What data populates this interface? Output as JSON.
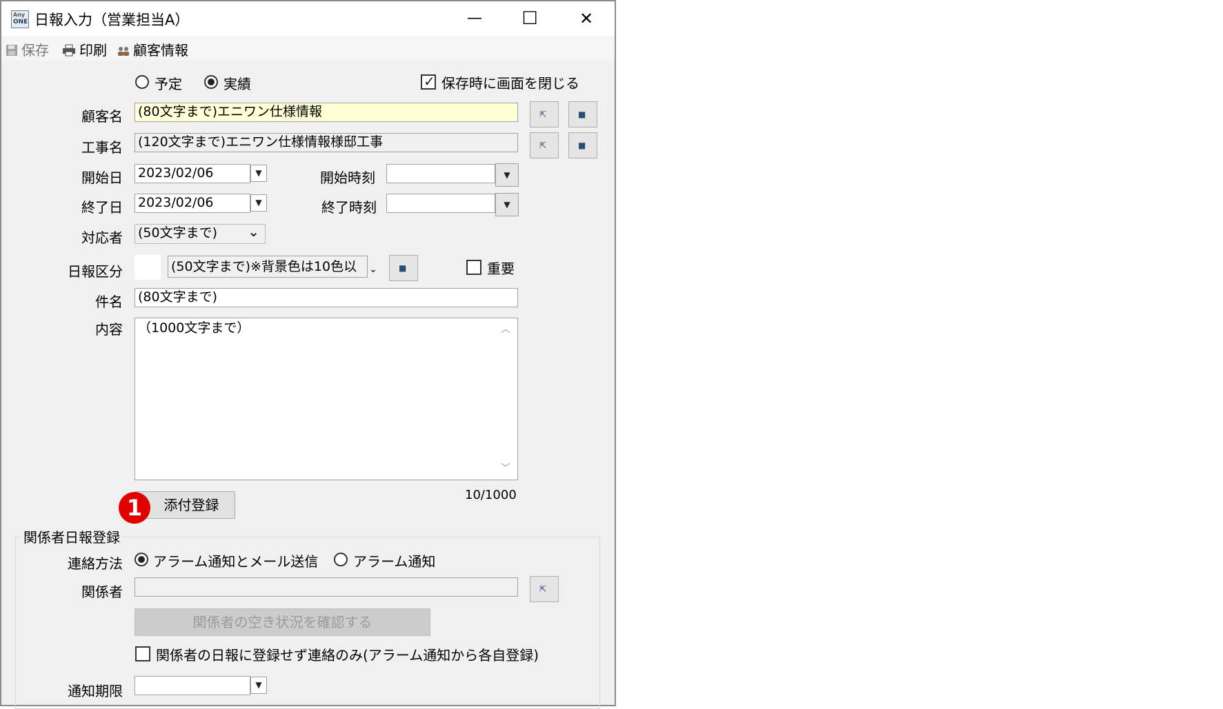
{
  "window": {
    "title": "日報入力（営業担当A）",
    "app_icon_top": "Any",
    "app_icon_bottom": "ONE",
    "minimize_glyph": "—",
    "maximize_glyph": "☐",
    "close_glyph": "✕"
  },
  "toolbar": {
    "save_label": "保存",
    "print_label": "印刷",
    "customer_info_label": "顧客情報"
  },
  "mode": {
    "plan_label": "予定",
    "actual_label": "実績",
    "selected": "actual",
    "close_on_save_label": "保存時に画面を閉じる",
    "close_on_save_checked": true
  },
  "form": {
    "customer_label": "顧客名",
    "customer_value": "(80文字まで)エニワン仕様情報",
    "project_label": "工事名",
    "project_value": "(120文字まで)エニワン仕様情報様邸工事",
    "start_date_label": "開始日",
    "start_date_value": "2023/02/06",
    "start_time_label": "開始時刻",
    "start_time_value": "",
    "end_date_label": "終了日",
    "end_date_value": "2023/02/06",
    "end_time_label": "終了時刻",
    "end_time_value": "",
    "handler_label": "対応者",
    "handler_value": "(50文字まで)",
    "category_label": "日報区分",
    "category_value": "(50文字まで)※背景色は10色以",
    "important_label": "重要",
    "important_checked": false,
    "subject_label": "件名",
    "subject_value": "(80文字まで)",
    "content_label": "内容",
    "content_value": "（1000文字まで）",
    "char_count": "10/1000",
    "attach_button_label": "添付登録",
    "badge_number": "1"
  },
  "related": {
    "group_title": "関係者日報登録",
    "contact_method_label": "連絡方法",
    "option_alarm_mail_label": "アラーム通知とメール送信",
    "option_alarm_label": "アラーム通知",
    "selected_option": "alarm_mail",
    "persons_label": "関係者",
    "persons_value": "",
    "check_availability_label": "関係者の空き状況を確認する",
    "notify_only_label": "関係者の日報に登録せず連絡のみ(アラーム通知から各自登録)",
    "notify_only_checked": false,
    "notify_deadline_label": "通知期限",
    "notify_deadline_value": ""
  },
  "icons": {
    "dropdown_arrow": "▼",
    "chevron_down": "⌄",
    "scroll_up": "︿",
    "scroll_down": "﹀",
    "select_glyph": "⇱",
    "detail_glyph": "■",
    "checkmark": "✓"
  },
  "colors": {
    "highlight_field": "#ffffd8",
    "badge": "#e00000",
    "window_bg": "#f0f0f0"
  }
}
